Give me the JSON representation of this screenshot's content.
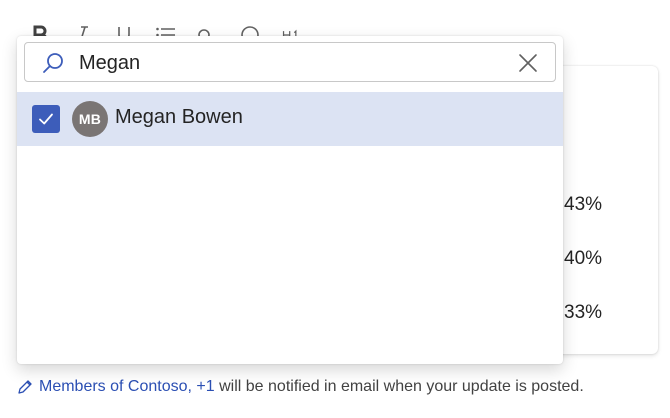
{
  "search": {
    "value": "Megan",
    "placeholder": ""
  },
  "results": [
    {
      "initials": "MB",
      "name": "Megan Bowen",
      "checked": true
    }
  ],
  "card": {
    "percentages": [
      "43%",
      "40%",
      "33%"
    ]
  },
  "footer": {
    "group_link": "Members of Contoso,",
    "more_link": "+1",
    "message": "will be notified in email when your update is posted."
  },
  "colors": {
    "accent": "#3d5dba",
    "selected_row": "#dce3f3",
    "link": "#2b4fb3",
    "avatar_bg": "#7a7574"
  },
  "icons": {
    "search": "search-icon",
    "clear": "close-icon",
    "check": "checkmark-icon",
    "edit": "pencil-icon"
  }
}
